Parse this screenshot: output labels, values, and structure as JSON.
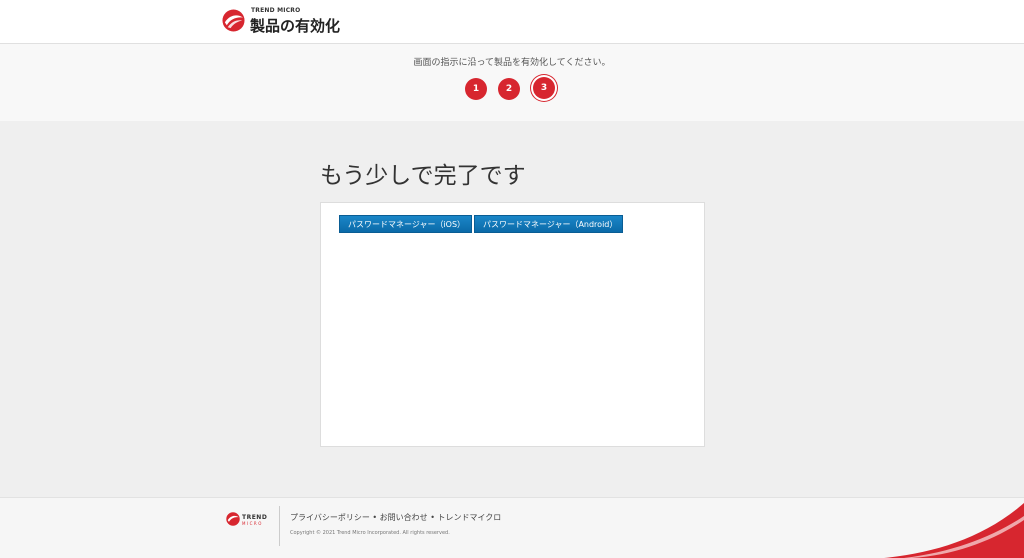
{
  "header": {
    "brand_small": "TREND MICRO",
    "title": "製品の有効化"
  },
  "steps": {
    "instruction": "画面の指示に沿って製品を有効化してください。",
    "items": [
      "1",
      "2",
      "3"
    ],
    "active": "3"
  },
  "main": {
    "title": "もう少しで完了です",
    "buttons": {
      "ios": "パスワードマネージャー（iOS）",
      "android": "パスワードマネージャー（Android）"
    }
  },
  "footer": {
    "logo_text": "TREND",
    "logo_sub": "MICRO",
    "links": [
      "プライバシーポリシー",
      "お問い合わせ",
      "トレンドマイクロ"
    ],
    "separator": "•",
    "copyright": "Copyright © 2021 Trend Micro Incorporated. All rights reserved."
  },
  "colors": {
    "brand_red": "#d7262f",
    "button_blue": "#0b6aa8"
  }
}
